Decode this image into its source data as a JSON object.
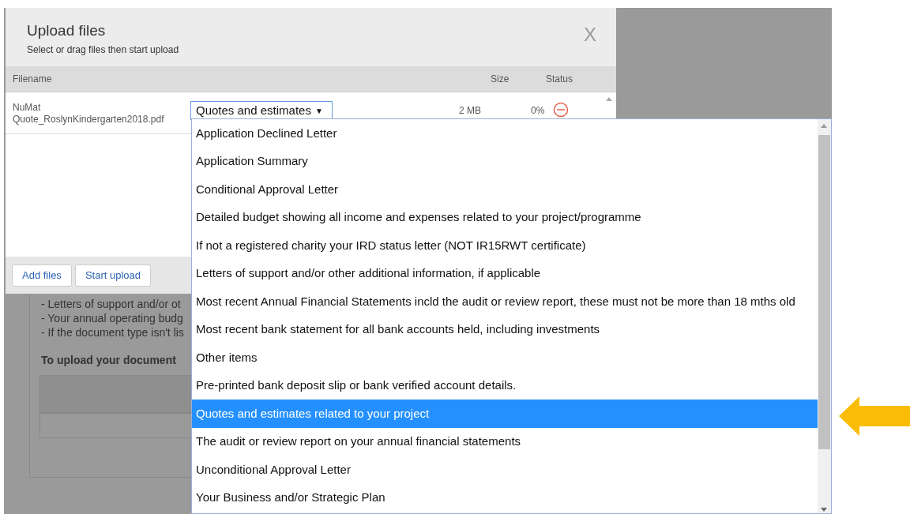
{
  "background_page": {
    "lines": [
      "- Letters of support and/or ot",
      "- Your annual operating budg",
      "- If the document type isn't lis"
    ],
    "heading": "To upload your document"
  },
  "dialog": {
    "title": "Upload files",
    "subtitle": "Select or drag files then start upload",
    "close": "X",
    "columns": [
      "Filename",
      "Size",
      "Status"
    ],
    "files": [
      {
        "name": "NuMat Quote_RoslynKindergarten2018.pdf",
        "document_type": "Quotes and estimates",
        "caret": "▼",
        "size": "2 MB",
        "status": "0%"
      }
    ],
    "buttons": [
      "Add files",
      "Start upload"
    ]
  },
  "dropdown": {
    "options": [
      {
        "label": "Application Declined Letter",
        "selected": false
      },
      {
        "label": "Application Summary",
        "selected": false
      },
      {
        "label": "Conditional Approval Letter",
        "selected": false
      },
      {
        "label": "Detailed budget showing all income and expenses related to your project/programme",
        "selected": false
      },
      {
        "label": "If not a registered charity your IRD status letter (NOT IR15RWT certificate)",
        "selected": false
      },
      {
        "label": "Letters of support and/or other additional information, if applicable",
        "selected": false
      },
      {
        "label": "Most recent Annual Financial Statements incld the audit or review report, these must not be more than 18 mths old",
        "selected": false
      },
      {
        "label": "Most recent bank statement for all bank accounts held, including investments",
        "selected": false
      },
      {
        "label": "Other items",
        "selected": false
      },
      {
        "label": "Pre-printed bank deposit slip or bank verified account details.",
        "selected": false
      },
      {
        "label": "Quotes and estimates related to your project",
        "selected": true
      },
      {
        "label": "The audit or review report on your annual financial statements",
        "selected": false
      },
      {
        "label": "Unconditional Approval Letter",
        "selected": false
      },
      {
        "label": "Your Business and/or Strategic Plan",
        "selected": false
      }
    ]
  }
}
